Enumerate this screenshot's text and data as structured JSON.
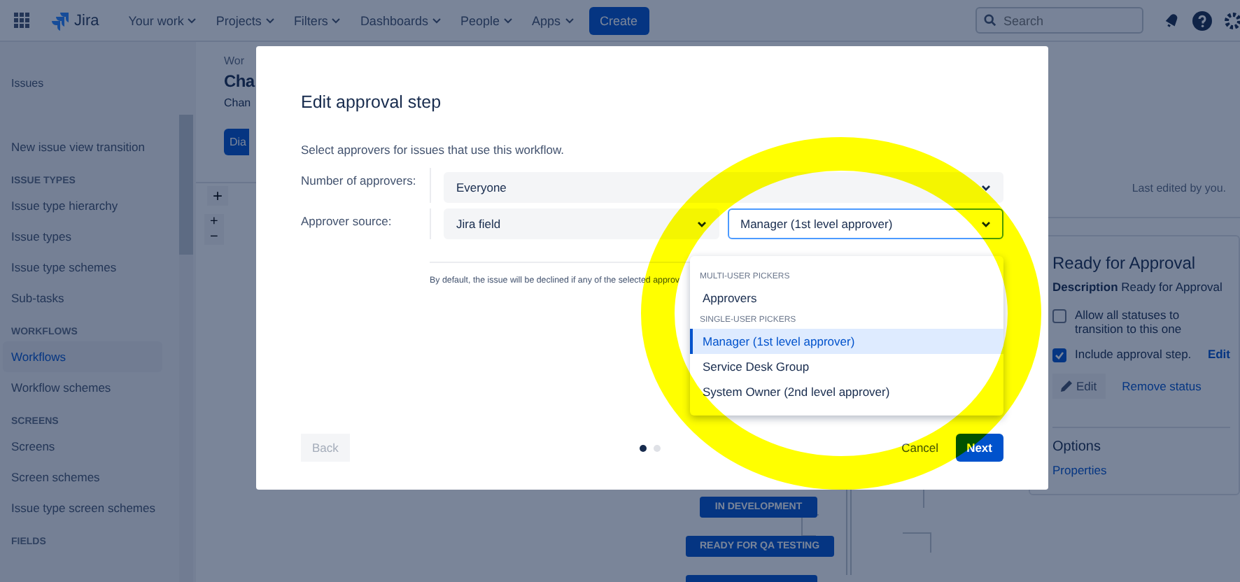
{
  "nav": {
    "logo": "Jira",
    "items": [
      "Your work",
      "Projects",
      "Filters",
      "Dashboards",
      "People",
      "Apps"
    ],
    "create": "Create",
    "search": {
      "placeholder": "Search"
    }
  },
  "sidebar": {
    "title": "Issues",
    "items": [
      {
        "kind": "item",
        "label": "New issue view transition",
        "selected": false
      },
      {
        "kind": "header",
        "label": "ISSUE TYPES"
      },
      {
        "kind": "item",
        "label": "Issue type hierarchy",
        "selected": false
      },
      {
        "kind": "item",
        "label": "Issue types",
        "selected": false
      },
      {
        "kind": "item",
        "label": "Issue type schemes",
        "selected": false
      },
      {
        "kind": "item",
        "label": "Sub-tasks",
        "selected": false
      },
      {
        "kind": "header",
        "label": "WORKFLOWS"
      },
      {
        "kind": "item",
        "label": "Workflows",
        "selected": true
      },
      {
        "kind": "item",
        "label": "Workflow schemes",
        "selected": false
      },
      {
        "kind": "header",
        "label": "SCREENS"
      },
      {
        "kind": "item",
        "label": "Screens",
        "selected": false
      },
      {
        "kind": "item",
        "label": "Screen schemes",
        "selected": false
      },
      {
        "kind": "item",
        "label": "Issue type screen schemes",
        "selected": false
      },
      {
        "kind": "header",
        "label": "FIELDS"
      }
    ]
  },
  "page": {
    "breadcrumb": "Wor",
    "title": "Cha",
    "description": "Chan",
    "diagram_button": "Dia",
    "zoom_in": "+",
    "zoom_out": "−",
    "add": "+"
  },
  "diagram": {
    "nodes": [
      "IN DEVELOPMENT",
      "READY FOR QA TESTING"
    ]
  },
  "side_panel": {
    "last_edited": "Last edited by you.",
    "status_title": "Ready for Approval",
    "description_label": "Description",
    "description_value": "Ready for Approval",
    "allow_all": {
      "label": "Allow all statuses to transition to this one",
      "checked": false
    },
    "include_approval": {
      "label": "Include approval step.",
      "checked": true
    },
    "edit_link": "Edit",
    "edit_button": "Edit",
    "remove": "Remove status",
    "options_title": "Options",
    "properties": "Properties"
  },
  "modal": {
    "title": "Edit approval step",
    "intro": "Select approvers for issues that use this workflow.",
    "count": {
      "label": "Number of approvers:",
      "value": "Everyone"
    },
    "source": {
      "label": "Approver source:",
      "type": "Jira field",
      "field": "Manager (1st level approver)"
    },
    "note": "By default, the issue will be declined if any of the selected approv",
    "dropdown": {
      "groups": [
        {
          "heading": "MULTI-USER PICKERS",
          "options": [
            {
              "label": "Approvers",
              "selected": false
            }
          ]
        },
        {
          "heading": "SINGLE-USER PICKERS",
          "options": [
            {
              "label": "Manager (1st level approver)",
              "selected": true
            },
            {
              "label": "Service Desk Group",
              "selected": false
            },
            {
              "label": "System Owner (2nd level approver)",
              "selected": false
            }
          ]
        }
      ]
    },
    "steps": [
      {
        "selected": true
      },
      {
        "selected": false
      }
    ],
    "back": "Back",
    "cancel": "Cancel",
    "next": "Next"
  }
}
